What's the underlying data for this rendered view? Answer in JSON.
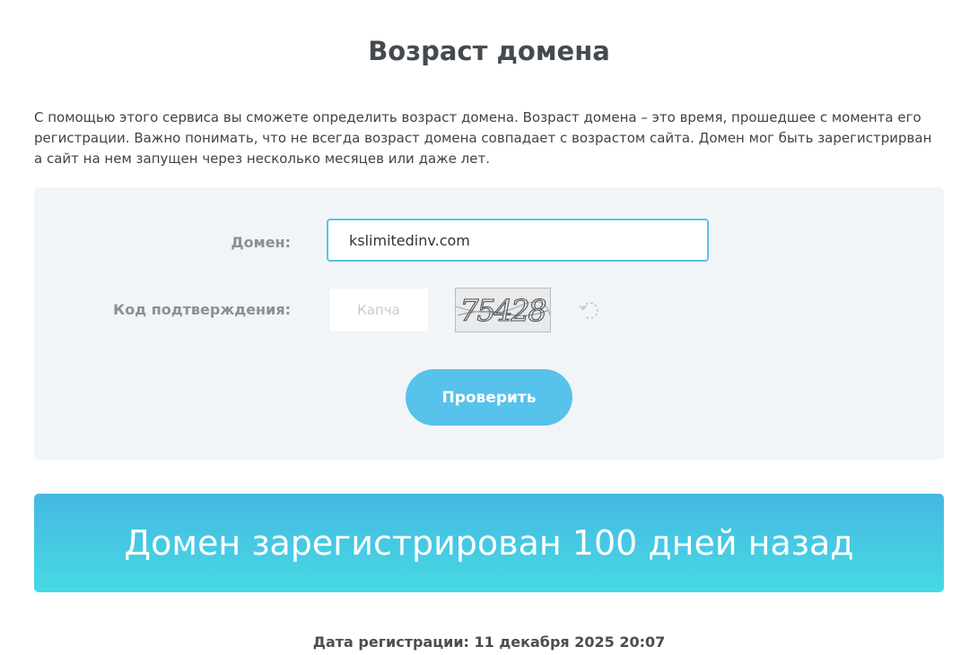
{
  "page": {
    "title": "Возраст домена",
    "description": "С помощью этого сервиса вы сможете определить возраст домена. Возраст домена – это время, прошедшее с момента его регистрации. Важно понимать, что не всегда возраст домена совпадает с возрастом сайта. Домен мог быть зарегистрирван а сайт на нем запущен через несколько месяцев или даже лет."
  },
  "form": {
    "domain_label": "Домен:",
    "domain_value": "kslimitedinv.com",
    "captcha_label": "Код подтверждения:",
    "captcha_placeholder": "Капча",
    "captcha_value": "",
    "captcha_image_text": "75428",
    "refresh_icon": "refresh-icon",
    "submit_label": "Проверить"
  },
  "result": {
    "message": "Домен зарегистрирован 100 дней назад",
    "registration_date": "Дата регистрации: 11 декабря 2025 20:07"
  },
  "colors": {
    "accent": "#57c2ec",
    "input_border_focus": "#5bc1e8",
    "panel_background": "#f2f5f7",
    "banner_gradient_top": "#45b8e3",
    "banner_gradient_bottom": "#47d9e3",
    "title_text": "#454a4f",
    "label_text": "#8c9093"
  }
}
